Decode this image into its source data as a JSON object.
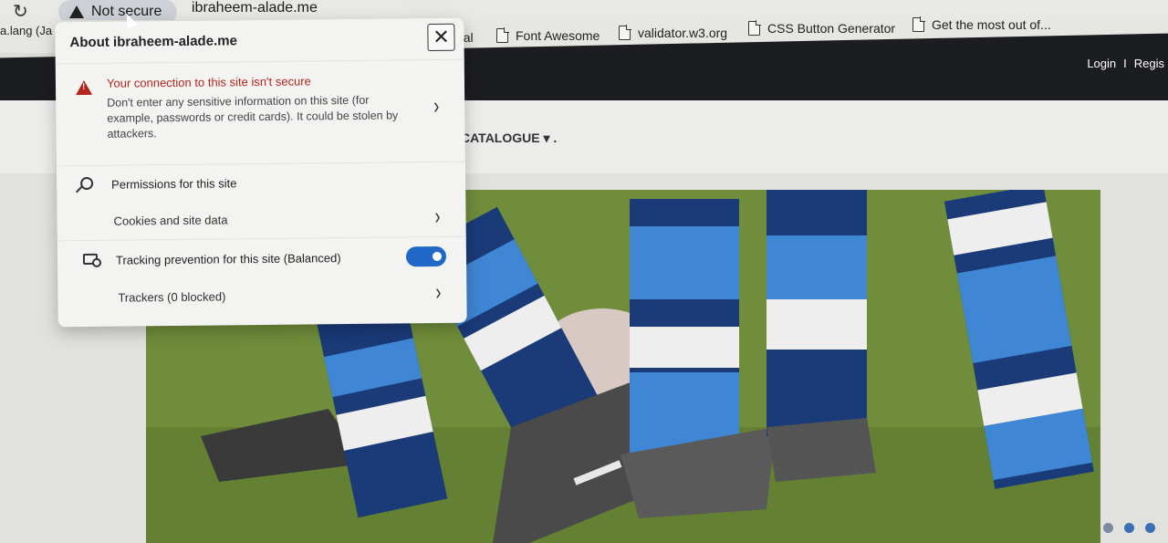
{
  "browser": {
    "security_label": "Not secure",
    "url": "ibraheem-alade.me"
  },
  "bookmarks": {
    "first": "a.lang (Ja",
    "items": [
      "rial",
      "Font Awesome",
      "validator.w3.org",
      "CSS Button Generator",
      "Get the most out of..."
    ]
  },
  "site": {
    "login": "Login",
    "separator": "I",
    "register": "Regis",
    "menu_catalogue": "CATALOGUE ▾ ."
  },
  "flyout": {
    "title": "About ibraheem-alade.me",
    "connection_title": "Your connection to this site isn't secure",
    "connection_body": "Don't enter any sensitive information on this site (for example, passwords or credit cards). It could be stolen by attackers.",
    "permissions": "Permissions for this site",
    "cookies": "Cookies and site data",
    "tracking": "Tracking prevention for this site (Balanced)",
    "tracking_enabled": true,
    "trackers": "Trackers (0 blocked)"
  },
  "carousel": {
    "slides": 3,
    "active": 2
  },
  "colors": {
    "accent": "#1f68c8",
    "warning": "#b3261e",
    "nav": "#1c1d20"
  }
}
